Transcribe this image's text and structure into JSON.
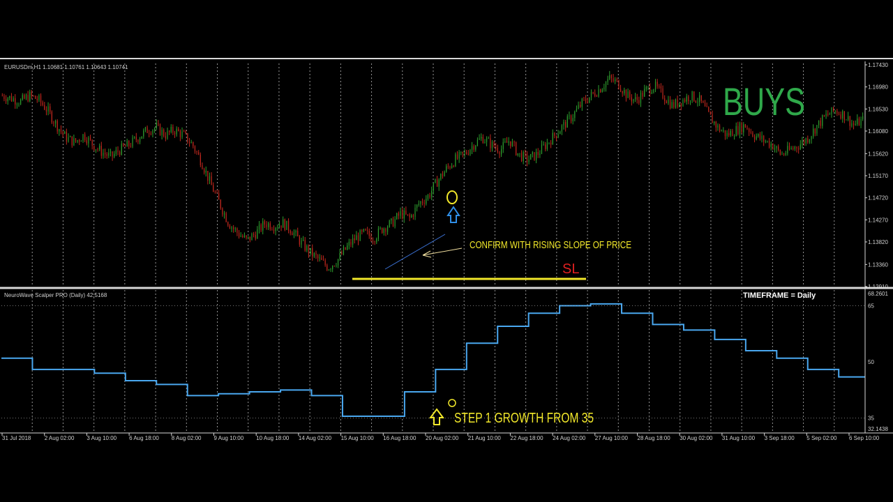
{
  "colors": {
    "background": "#000000",
    "frame": "#d8d8d8",
    "grid": "#c8c8c8",
    "text": "#d0d0d0",
    "bull": "#2e9e2e",
    "bear": "#c0281e",
    "indicator": "#4aa8f0",
    "annotation_yellow": "#f2e82a",
    "buys_green": "#2fa84a",
    "sl_red": "#e02020",
    "arrow_blue": "#2f8fe8"
  },
  "main_header": "EURUSDm,H1  1.10681 1.10761 1.10643 1.10741",
  "indicator_header": "NeuroWave Scalper PRO (Daily) 42.5168",
  "timeframe_label": "TIMEFRAME = Daily",
  "annotations": {
    "buys": "BUYS",
    "confirm": "CONFIRM WITH RISING SLOPE OF PRICE",
    "sl": "SL",
    "step1": "STEP 1 GROWTH FROM 35",
    "up_arrow_icon": "up-arrow-icon"
  },
  "chart_data": [
    {
      "type": "candlestick",
      "title": "EURUSDm,H1",
      "y_ticks": [
        "1.17430",
        "1.16980",
        "1.16530",
        "1.16080",
        "1.15620",
        "1.15170",
        "1.14720",
        "1.14270",
        "1.13820",
        "1.13360",
        "1.12910"
      ],
      "ylim": [
        1.1291,
        1.1743
      ],
      "close_path": [
        [
          0,
          1.168
        ],
        [
          2,
          1.1675
        ],
        [
          4,
          1.1668
        ],
        [
          6,
          1.168
        ],
        [
          8,
          1.1672
        ],
        [
          10,
          1.165
        ],
        [
          12,
          1.162
        ],
        [
          14,
          1.1595
        ],
        [
          16,
          1.1585
        ],
        [
          18,
          1.16
        ],
        [
          20,
          1.158
        ],
        [
          22,
          1.1565
        ],
        [
          24,
          1.1555
        ],
        [
          26,
          1.157
        ],
        [
          28,
          1.158
        ],
        [
          30,
          1.1595
        ],
        [
          32,
          1.161
        ],
        [
          34,
          1.1615
        ],
        [
          36,
          1.16
        ],
        [
          38,
          1.161
        ],
        [
          40,
          1.16
        ],
        [
          42,
          1.158
        ],
        [
          44,
          1.1545
        ],
        [
          46,
          1.15
        ],
        [
          48,
          1.146
        ],
        [
          50,
          1.142
        ],
        [
          52,
          1.14
        ],
        [
          54,
          1.1385
        ],
        [
          56,
          1.14
        ],
        [
          58,
          1.142
        ],
        [
          60,
          1.1415
        ],
        [
          62,
          1.142
        ],
        [
          64,
          1.1405
        ],
        [
          66,
          1.138
        ],
        [
          68,
          1.136
        ],
        [
          70,
          1.1345
        ],
        [
          72,
          1.133
        ],
        [
          74,
          1.1345
        ],
        [
          76,
          1.137
        ],
        [
          78,
          1.139
        ],
        [
          80,
          1.14
        ],
        [
          82,
          1.139
        ],
        [
          84,
          1.141
        ],
        [
          86,
          1.142
        ],
        [
          88,
          1.144
        ],
        [
          90,
          1.143
        ],
        [
          92,
          1.146
        ],
        [
          94,
          1.1475
        ],
        [
          96,
          1.1505
        ],
        [
          98,
          1.153
        ],
        [
          100,
          1.155
        ],
        [
          102,
          1.156
        ],
        [
          104,
          1.158
        ],
        [
          106,
          1.1595
        ],
        [
          108,
          1.158
        ],
        [
          110,
          1.157
        ],
        [
          112,
          1.159
        ],
        [
          114,
          1.156
        ],
        [
          116,
          1.155
        ],
        [
          118,
          1.156
        ],
        [
          120,
          1.158
        ],
        [
          122,
          1.16
        ],
        [
          124,
          1.162
        ],
        [
          126,
          1.164
        ],
        [
          128,
          1.1665
        ],
        [
          130,
          1.168
        ],
        [
          132,
          1.1695
        ],
        [
          134,
          1.1715
        ],
        [
          136,
          1.1705
        ],
        [
          138,
          1.168
        ],
        [
          140,
          1.167
        ],
        [
          142,
          1.169
        ],
        [
          144,
          1.17
        ],
        [
          146,
          1.168
        ],
        [
          148,
          1.166
        ],
        [
          150,
          1.167
        ],
        [
          152,
          1.168
        ],
        [
          154,
          1.167
        ],
        [
          156,
          1.164
        ],
        [
          158,
          1.1615
        ],
        [
          160,
          1.16
        ],
        [
          162,
          1.161
        ],
        [
          164,
          1.162
        ],
        [
          166,
          1.16
        ],
        [
          168,
          1.159
        ],
        [
          170,
          1.158
        ],
        [
          172,
          1.156
        ],
        [
          174,
          1.157
        ],
        [
          176,
          1.158
        ],
        [
          178,
          1.1595
        ],
        [
          180,
          1.162
        ],
        [
          182,
          1.164
        ],
        [
          184,
          1.165
        ],
        [
          186,
          1.164
        ],
        [
          188,
          1.162
        ],
        [
          190,
          1.163
        ]
      ]
    },
    {
      "type": "line",
      "title": "NeuroWave Scalper PRO (Daily) 42.5168",
      "y_ticks": [
        "68.2601",
        "65",
        "50",
        "35",
        "32.1438"
      ],
      "ylim": [
        32.1438,
        68.2601
      ],
      "x_labels": [
        "31 Jul 2018",
        "2 Aug 02:00",
        "3 Aug 10:00",
        "6 Aug 18:00",
        "8 Aug 02:00",
        "9 Aug 10:00",
        "10 Aug 18:00",
        "14 Aug 02:00",
        "15 Aug 10:00",
        "16 Aug 18:00",
        "20 Aug 02:00",
        "21 Aug 10:00",
        "22 Aug 18:00",
        "24 Aug 02:00",
        "27 Aug 10:00",
        "28 Aug 18:00",
        "30 Aug 02:00",
        "31 Aug 10:00",
        "3 Sep 18:00",
        "5 Sep 02:00",
        "6 Sep 10:00"
      ],
      "steps": [
        51,
        48,
        48,
        47,
        45,
        44,
        41,
        41.5,
        42,
        42.5,
        41,
        35.5,
        35.5,
        42,
        48,
        55,
        59.5,
        63,
        65,
        65.5,
        63,
        60,
        58.5,
        56,
        53,
        51,
        48,
        46
      ],
      "series": [
        {
          "values": [
            51,
            48,
            48,
            47,
            45,
            44,
            41,
            41.5,
            42,
            42.5,
            41,
            35.5,
            35.5,
            42,
            48,
            55,
            59.5,
            63,
            65,
            65.5,
            63,
            60,
            58.5,
            56,
            53,
            51,
            48,
            46
          ]
        }
      ]
    }
  ]
}
